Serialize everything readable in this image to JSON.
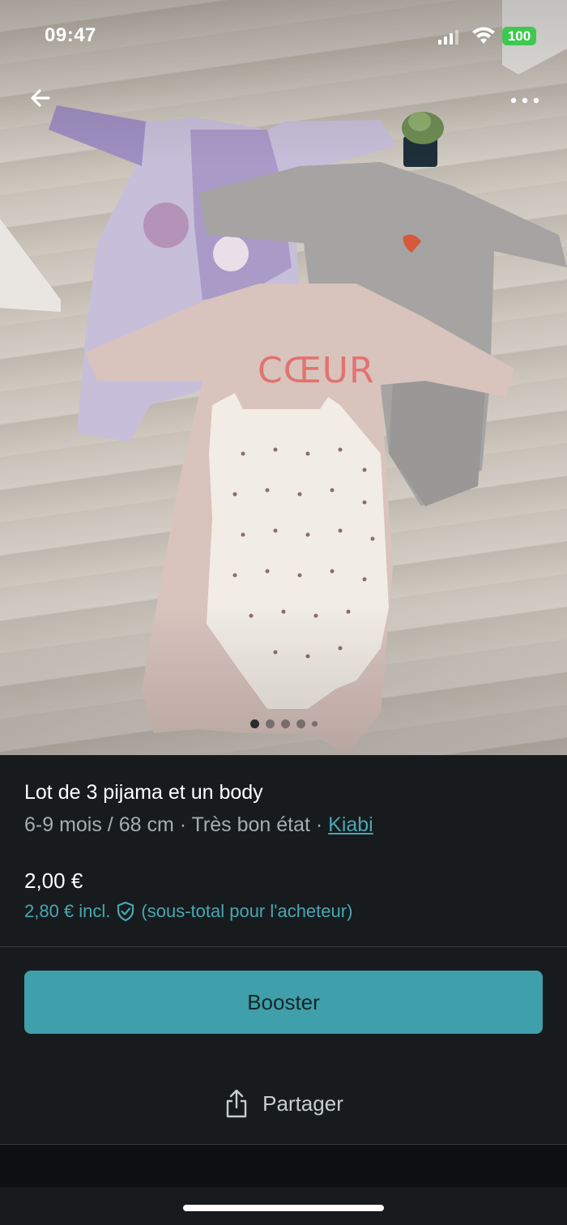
{
  "status_bar": {
    "time": "09:47",
    "battery": "100"
  },
  "gallery": {
    "image_count": 5,
    "active_index": 0
  },
  "listing": {
    "title": "Lot de 3 pijama et un body",
    "size": "6-9 mois / 68 cm",
    "separator": " · ",
    "condition": "Très bon état",
    "brand": "Kiabi",
    "price": "2,00 €",
    "price_incl": "2,80 € incl.",
    "price_incl_note": "(sous-total pour l'acheteur)"
  },
  "actions": {
    "booster_label": "Booster",
    "share_label": "Partager"
  },
  "colors": {
    "accent": "#4aa7b1",
    "button": "#3f9faa",
    "background": "#171b1d",
    "battery": "#3dc94f"
  },
  "icons": [
    "back-arrow-icon",
    "more-options-icon",
    "signal-icon",
    "wifi-icon",
    "shield-check-icon",
    "share-icon"
  ]
}
